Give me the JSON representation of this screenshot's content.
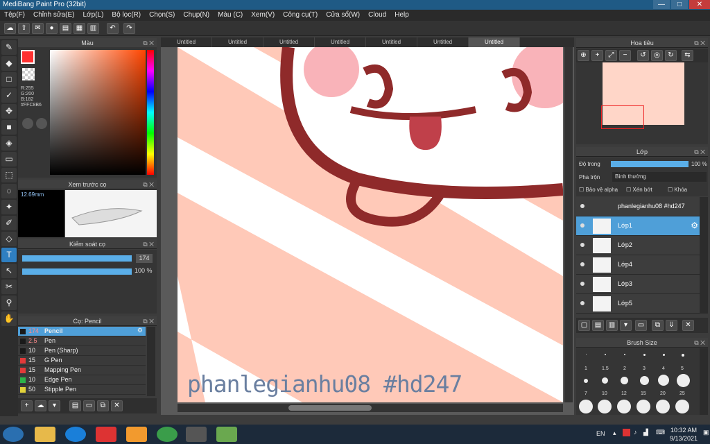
{
  "app": {
    "title": "MediBang Paint Pro (32bit)"
  },
  "menu": [
    "Tệp(F)",
    "Chỉnh sửa(E)",
    "Lớp(L)",
    "Bộ lọc(R)",
    "Chọn(S)",
    "Chụp(N)",
    "Màu (C)",
    "Xem(V)",
    "Công cụ(T)",
    "Cửa sổ(W)",
    "Cloud",
    "Help"
  ],
  "tabs": [
    "Untitled",
    "Untitled",
    "Untitled",
    "Untitled",
    "Untitled",
    "Untitled",
    "Untitled"
  ],
  "color_panel": {
    "title": "Màu",
    "r": "R:255",
    "g": "G:200",
    "b": "B:182",
    "hex": "#FFC8B6"
  },
  "brush_preview": {
    "title": "Xem trước cọ",
    "size": "12.69mm"
  },
  "brush_control": {
    "title": "Kiểm soát cọ",
    "size_value": "174",
    "opacity_value": "100 %"
  },
  "brush_list": {
    "title": "Cọ: Pencil",
    "items": [
      {
        "num": "174",
        "name": "Pencil",
        "color": "#1a1a1a"
      },
      {
        "num": "2.5",
        "name": "Pen",
        "color": "#1a1a1a"
      },
      {
        "num": "10",
        "name": "Pen (Sharp)",
        "color": "#1a1a1a"
      },
      {
        "num": "15",
        "name": "G Pen",
        "color": "#e23a3a"
      },
      {
        "num": "15",
        "name": "Mapping Pen",
        "color": "#e23a3a"
      },
      {
        "num": "10",
        "name": "Edge Pen",
        "color": "#2db34a"
      },
      {
        "num": "50",
        "name": "Stipple Pen",
        "color": "#e2d23a"
      }
    ]
  },
  "canvas": {
    "watermark": "phanlegianhu08 #hd247"
  },
  "navigator": {
    "title": "Hoa tiêu"
  },
  "layers_panel": {
    "title": "Lớp",
    "opacity_label": "Độ trong",
    "opacity_value": "100 %",
    "blend_label": "Pha trộn",
    "blend_value": "Bình thường",
    "protect_alpha": "Bảo vệ alpha",
    "clip": "Xén bớt",
    "lock": "Khóa",
    "layers": [
      {
        "name": "phanlegianhu08 #hd247"
      },
      {
        "name": "Lớp1"
      },
      {
        "name": "Lớp2"
      },
      {
        "name": "Lớp4"
      },
      {
        "name": "Lớp3"
      },
      {
        "name": "Lớp5"
      }
    ]
  },
  "brush_size": {
    "title": "Brush Size",
    "sizes": [
      "1",
      "1.5",
      "2",
      "3",
      "4",
      "5",
      "7",
      "10",
      "12",
      "15",
      "20",
      "25"
    ]
  },
  "taskbar": {
    "lang": "EN",
    "time": "10:32 AM",
    "date": "9/13/2021"
  },
  "colors": {
    "accent": "#4f9fd8",
    "foreground": "#FFC8B6"
  }
}
